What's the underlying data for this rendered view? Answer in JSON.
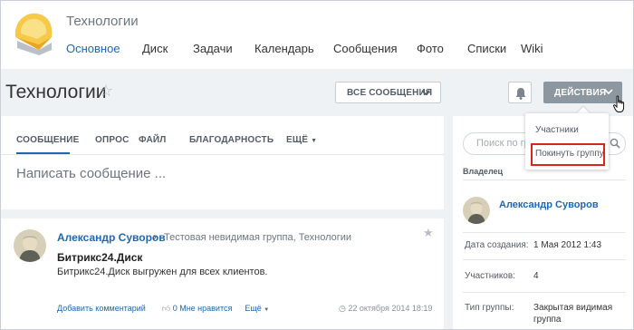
{
  "header": {
    "group_title": "Технологии",
    "nav": [
      "Основное",
      "Диск",
      "Задачи",
      "Календарь",
      "Сообщения",
      "Фото",
      "Списки",
      "Wiki"
    ]
  },
  "titlebar": {
    "title": "Технологии",
    "all_messages_label": "ВСЕ СООБЩЕНИЯ",
    "actions_label": "ДЕЙСТВИЯ"
  },
  "actions_menu": {
    "items": [
      "Участники",
      "Покинуть группу"
    ]
  },
  "composer": {
    "tabs": [
      "СООБЩЕНИЕ",
      "ОПРОС",
      "ФАЙЛ",
      "БЛАГОДАРНОСТЬ",
      "ЕЩЁ"
    ],
    "placeholder": "Написать сообщение ..."
  },
  "post": {
    "author": "Александр Суворов",
    "destination": "Тестовая невидимая группа, Технологии",
    "heading": "Битрикс24.Диск",
    "body": "Битрикс24.Диск выгружен для всех клиентов.",
    "add_comment": "Добавить комментарий",
    "like": "0 Мне нравится",
    "more": "Ещё",
    "date": "22 октября 2014 18:19"
  },
  "sidebar": {
    "search_placeholder": "Поиск по группе",
    "owner_label": "Владелец",
    "owner_name": "Александр Суворов",
    "created_label": "Дата создания:",
    "created_value": "1 Мая 2012 1:43",
    "members_label": "Участников:",
    "members_value": "4",
    "type_label": "Тип группы:",
    "type_value_1": "Закрытая видимая",
    "type_value_2": "группа"
  },
  "colors": {
    "accent_link": "#2067b0",
    "actions_button": "#8d979f",
    "highlight_border": "#d8261c",
    "page_bg": "#eef2f4"
  },
  "icons": [
    "group-logo-icon",
    "star-icon",
    "chevron-down-icon",
    "bell-icon",
    "hand-cursor-icon",
    "search-icon",
    "like-icon",
    "clock-icon"
  ]
}
